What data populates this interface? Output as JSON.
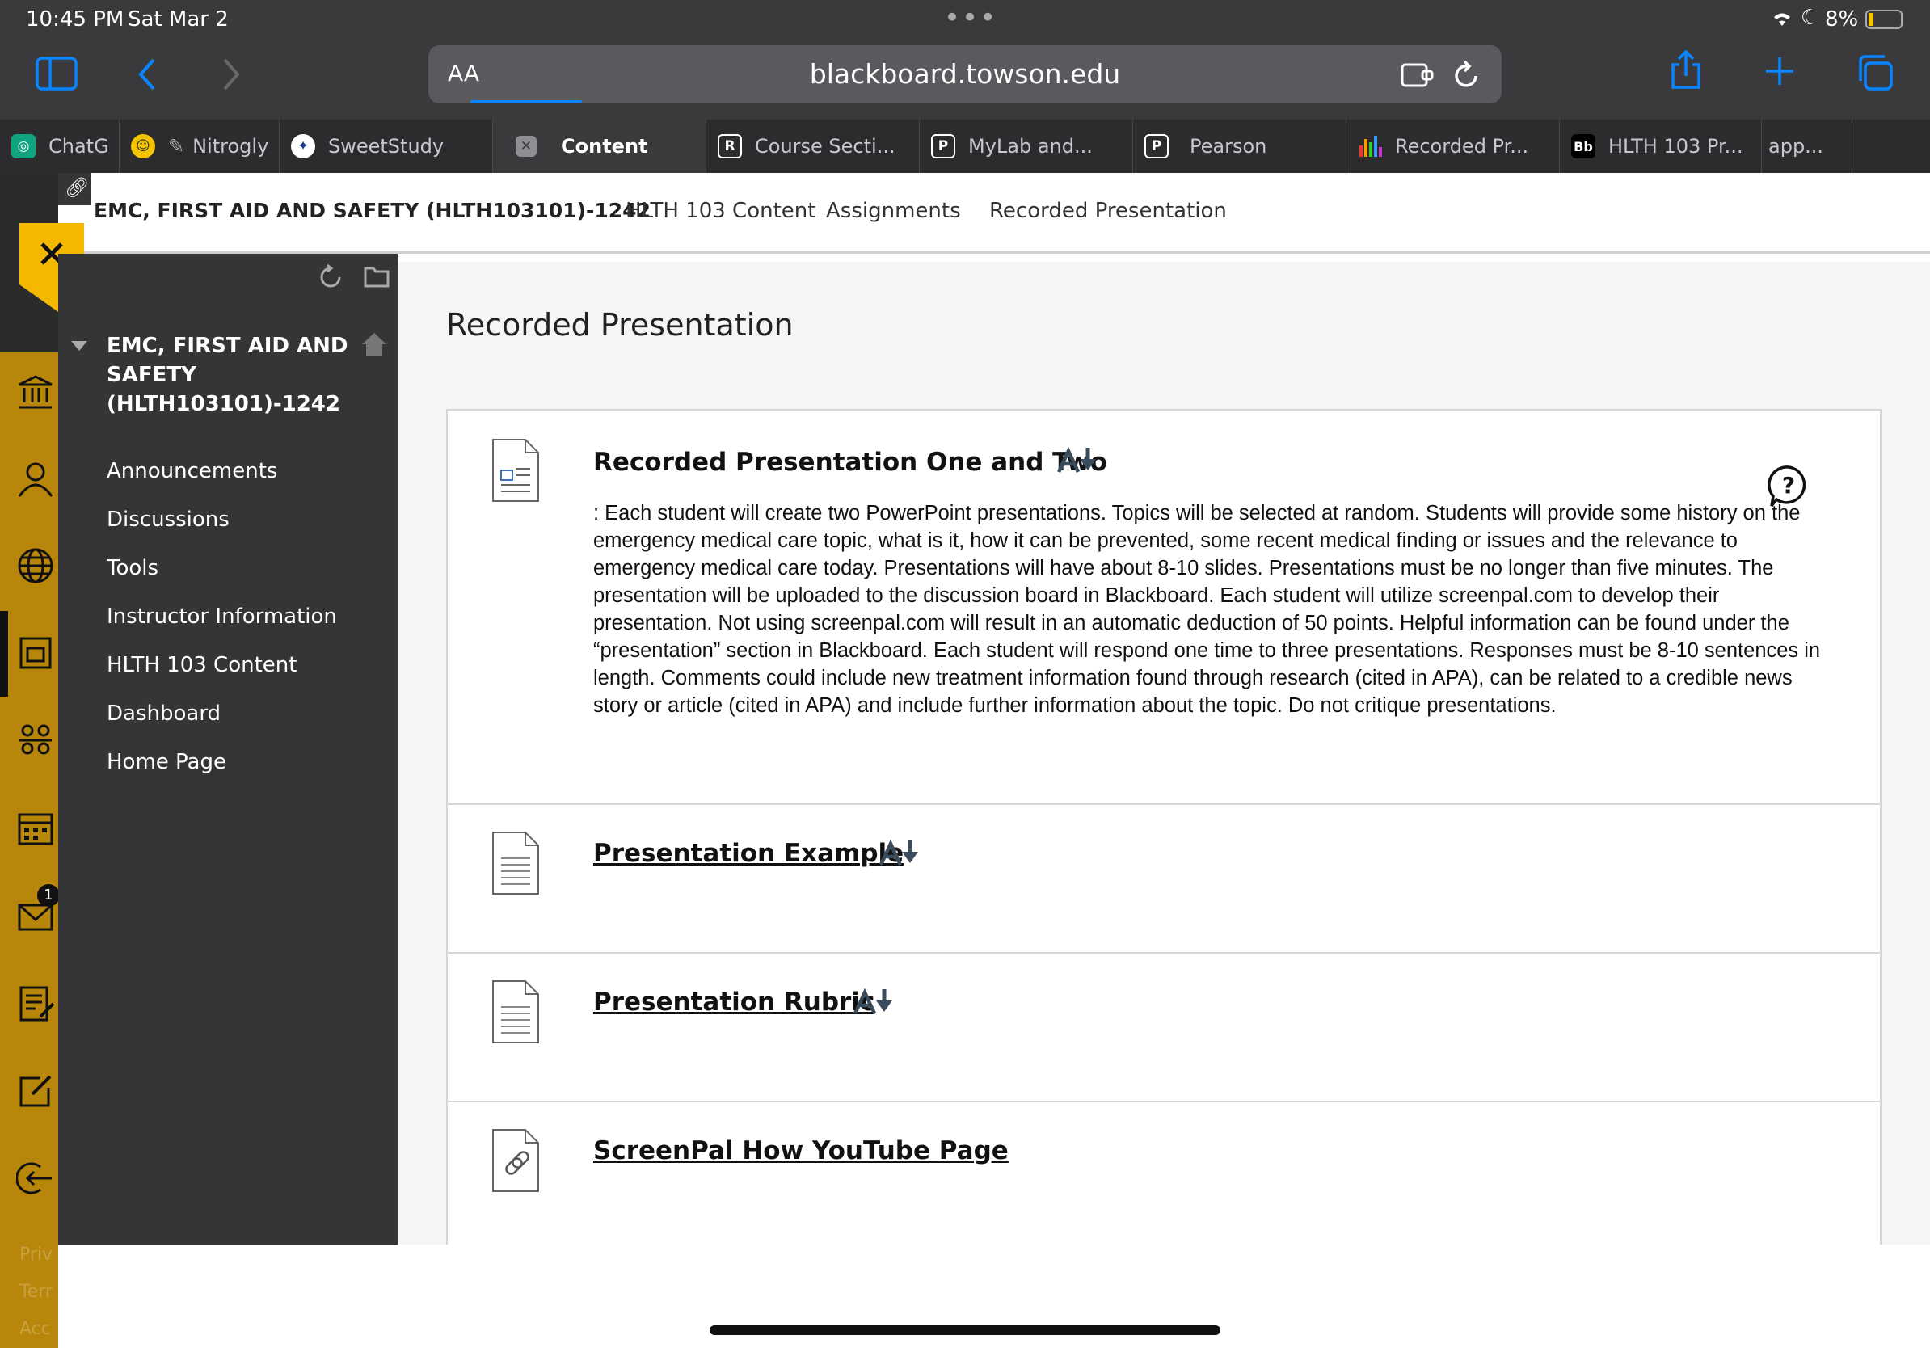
{
  "status": {
    "time": "10:45 PM",
    "date": "Sat Mar 2",
    "battery": "8%"
  },
  "browser": {
    "text_size_label": "AA",
    "url": "blackboard.towson.edu",
    "tabs": [
      {
        "label": "ChatG",
        "icon": "chatgpt-icon"
      },
      {
        "label": "Nitrogly",
        "icon": "emoji-icon"
      },
      {
        "label": "SweetStudy",
        "icon": "sweetstudy-icon"
      },
      {
        "label": "Content",
        "icon": "close-icon",
        "active": true
      },
      {
        "label": "Course Secti...",
        "icon": "R"
      },
      {
        "label": "MyLab and...",
        "icon": "P"
      },
      {
        "label": "Pearson",
        "icon": "P"
      },
      {
        "label": "Recorded Pr...",
        "icon": "bar-chart-icon"
      },
      {
        "label": "HLTH 103 Pr...",
        "icon": "Bb"
      },
      {
        "label": "app...",
        "icon": ""
      }
    ]
  },
  "course_header": {
    "title": "EMC, FIRST AID AND SAFETY (HLTH103101)-1242",
    "links": [
      "HLTH 103 Content",
      "Assignments",
      "Recorded Presentation"
    ]
  },
  "sidebar": {
    "course_title_lines": [
      "EMC, FIRST AID AND",
      "SAFETY",
      "(HLTH103101)-1242"
    ],
    "items": [
      "Announcements",
      "Discussions",
      "Tools",
      "Instructor Information",
      "HLTH 103 Content",
      "Dashboard",
      "Home Page"
    ]
  },
  "rail": {
    "mail_badge": "1",
    "footer": [
      "Priv",
      "Terr",
      "Acc"
    ]
  },
  "page": {
    "heading": "Recorded Presentation",
    "items": [
      {
        "title": "Recorded Presentation One and Two",
        "link": false,
        "description": ": Each student will create two PowerPoint presentations.  Topics will be selected at random.  Students will provide some history on the emergency medical care topic, what is it, how it can be prevented, some recent medical finding or issues and the relevance to emergency medical care today.  Presentations will have about 8-10 slides.  Presentations must be no longer than five minutes. The presentation will be uploaded to the discussion board in Blackboard.  Each student will utilize screenpal.com to develop their presentation.  Not using screenpal.com will result in an automatic deduction of 50 points.   Helpful information can be found under the “presentation” section in Blackboard.  Each student will respond one time to three presentations.  Responses must be 8-10 sentences in length.  Comments could include new treatment information found through research (cited in APA), can be related to a credible news story or article (cited in APA) and include further information about the topic. Do not critique presentations."
      },
      {
        "title": "Presentation Example",
        "link": true
      },
      {
        "title": "Presentation Rubric",
        "link": true
      },
      {
        "title": "ScreenPal How YouTube Page",
        "link": true
      }
    ]
  }
}
